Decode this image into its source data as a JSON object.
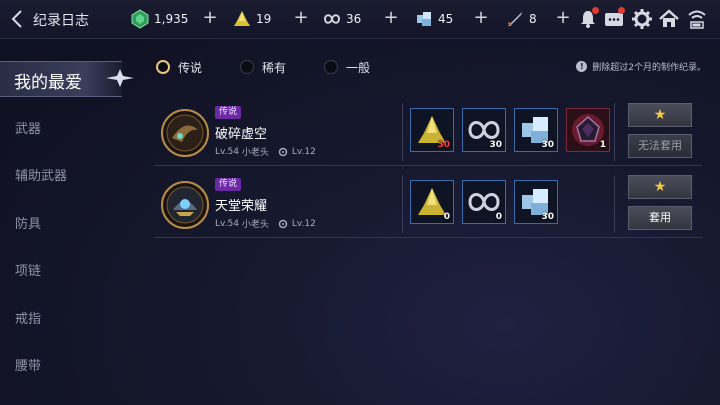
{
  "header": {
    "title": "纪录日志",
    "resources": [
      {
        "icon": "green-gem-icon",
        "value": "1,935"
      },
      {
        "icon": "gold-crystal-icon",
        "value": "19"
      },
      {
        "icon": "infinity-ring-icon",
        "value": "36"
      },
      {
        "icon": "ice-crystal-icon",
        "value": "45"
      },
      {
        "icon": "sword-icon",
        "value": "8"
      }
    ]
  },
  "sidebar": {
    "active": "我的最爱",
    "items": [
      "武器",
      "辅助武器",
      "防具",
      "项链",
      "戒指",
      "腰带"
    ]
  },
  "filters": {
    "options": [
      "传说",
      "稀有",
      "一般"
    ],
    "selected": "传说",
    "notice": "删除超过2个月的制作纪录。"
  },
  "recipes": [
    {
      "tag": "传说",
      "name": "破碎虚空",
      "level": "Lv.54",
      "creator": "小老头",
      "skill_level": "Lv.12",
      "materials": [
        {
          "icon": "gold-crystal-icon",
          "count": "30",
          "insufficient": true
        },
        {
          "icon": "infinity-ring-icon",
          "count": "30",
          "insufficient": false
        },
        {
          "icon": "ice-crystal-icon",
          "count": "30",
          "insufficient": false
        },
        {
          "icon": "dark-core-icon",
          "count": "1",
          "insufficient": false
        }
      ],
      "favorite_label": "★",
      "apply_label": "无法套用",
      "apply_enabled": false
    },
    {
      "tag": "传说",
      "name": "天堂荣耀",
      "level": "Lv.54",
      "creator": "小老头",
      "skill_level": "Lv.12",
      "materials": [
        {
          "icon": "gold-crystal-icon",
          "count": "0",
          "insufficient": false
        },
        {
          "icon": "infinity-ring-icon",
          "count": "0",
          "insufficient": false
        },
        {
          "icon": "ice-crystal-icon",
          "count": "30",
          "insufficient": false
        }
      ],
      "favorite_label": "★",
      "apply_label": "套用",
      "apply_enabled": true
    }
  ],
  "colors": {
    "accent_gold": "#e9c97c",
    "legend_tag": "#6b2aa3",
    "insufficient_red": "#ff3b3b",
    "slot_border": "#3b6aa8"
  }
}
